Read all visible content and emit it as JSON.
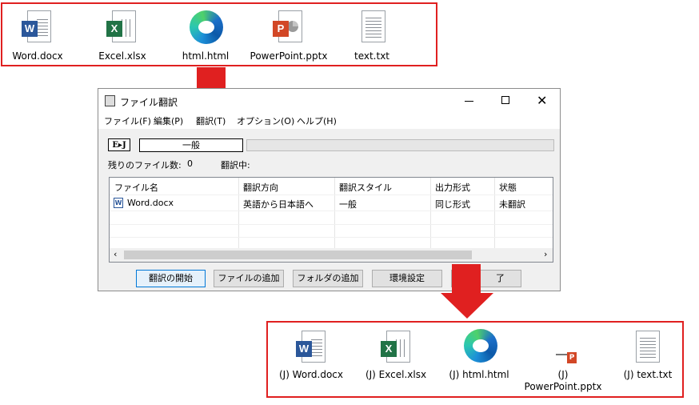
{
  "top_files": [
    {
      "label": "Word.docx",
      "icon": "word-icon"
    },
    {
      "label": "Excel.xlsx",
      "icon": "excel-icon"
    },
    {
      "label": "html.html",
      "icon": "edge-icon"
    },
    {
      "label": "PowerPoint.pptx",
      "icon": "powerpoint-icon"
    },
    {
      "label": "text.txt",
      "icon": "text-file-icon"
    }
  ],
  "bottom_files": [
    {
      "label": "(J) Word.docx",
      "icon": "word-icon"
    },
    {
      "label": "(J) Excel.xlsx",
      "icon": "excel-icon"
    },
    {
      "label": "(J) html.html",
      "icon": "edge-icon"
    },
    {
      "label_line1": "(J)",
      "label_line2": "PowerPoint.pptx",
      "icon": "powerpoint-thumbnail-icon"
    },
    {
      "label": "(J) text.txt",
      "icon": "text-file-icon"
    }
  ],
  "window": {
    "title": "ファイル翻訳",
    "menu": [
      "ファイル(F)",
      "編集(P)",
      "翻訳(T)",
      "オプション(O)",
      "ヘルプ(H)"
    ],
    "ej_label": "E▸J",
    "mode": "一般",
    "remaining_label": "残りのファイル数:",
    "remaining_count": "0",
    "translating_label": "翻訳中:",
    "columns": [
      "ファイル名",
      "翻訳方向",
      "翻訳スタイル",
      "出力形式",
      "状態"
    ],
    "rows": [
      {
        "file": "Word.docx",
        "direction": "英語から日本語へ",
        "style": "一般",
        "format": "同じ形式",
        "status": "未翻訳"
      }
    ],
    "buttons": {
      "start": "翻訳の開始",
      "add_file": "ファイルの追加",
      "add_folder": "フォルダの追加",
      "settings": "環境設定",
      "close_partial": "了"
    }
  },
  "colors": {
    "highlight": "#e02020",
    "word": "#2b579a",
    "excel": "#217346",
    "powerpoint": "#d24726"
  }
}
